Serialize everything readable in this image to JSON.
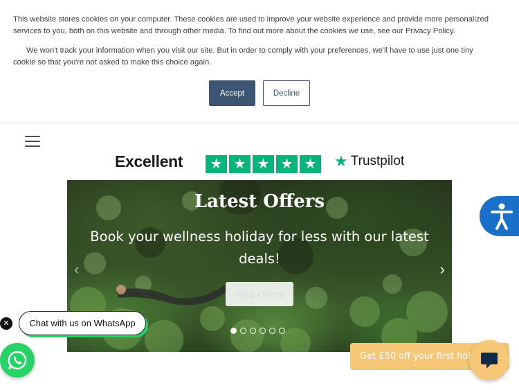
{
  "cookie_banner": {
    "text_primary": "This website stores cookies on your computer. These cookies are used to improve your website experience and provide more personalized services to you, both on this website and through other media. To find out more about the cookies we use, see our Privacy Policy.",
    "text_secondary": "We won't track your information when you visit our site. But in order to comply with your preferences, we'll have to use just one tiny cookie so that you're not asked to make this choice again.",
    "accept_label": "Accept",
    "decline_label": "Decline"
  },
  "header": {
    "menu_icon": "hamburger-icon"
  },
  "trustpilot": {
    "rating_label": "Excellent",
    "star_count": 5,
    "brand": "Trustpilot",
    "star_color": "#00b67a"
  },
  "hero": {
    "title": "Latest Offers",
    "subtitle": "Book your wellness holiday for less with our latest deals!",
    "button_label": "Find Offers",
    "slide_count": 6,
    "active_slide": 1,
    "prev_icon": "chevron-left-icon",
    "next_icon": "chevron-right-icon"
  },
  "accessibility": {
    "icon": "accessibility-icon",
    "color": "#1a6fc8"
  },
  "whatsapp": {
    "chat_label": "Chat with us on WhatsApp",
    "close_icon": "close-icon",
    "icon": "whatsapp-icon",
    "color": "#25d366"
  },
  "promo": {
    "text": "Get £50 off your first hol",
    "color": "#f6c777",
    "chat_icon": "chat-bubble-icon"
  }
}
